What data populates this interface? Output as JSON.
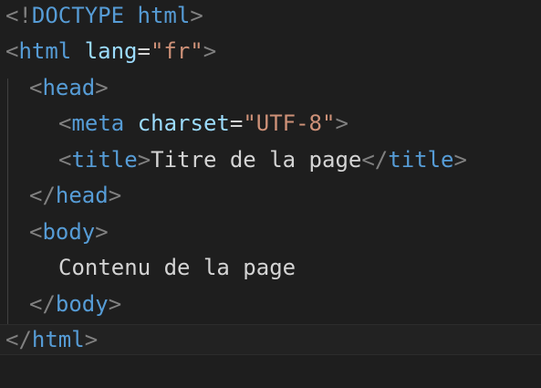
{
  "editor": {
    "language": "html",
    "highlighted_line": 9,
    "colors": {
      "background": "#1e1e1e",
      "tag": "#569cd6",
      "bracket": "#808080",
      "attribute": "#9cdcfe",
      "string": "#ce9178",
      "text": "#d4d4d4"
    },
    "lines": {
      "l1": {
        "open": "<!",
        "name": "DOCTYPE",
        "attr": "html",
        "close": ">"
      },
      "l2": {
        "open": "<",
        "name": "html",
        "attr": "lang",
        "eq": "=",
        "value": "\"fr\"",
        "close": ">"
      },
      "l3": {
        "open": "<",
        "name": "head",
        "close": ">"
      },
      "l4": {
        "open": "<",
        "name": "meta",
        "attr": "charset",
        "eq": "=",
        "value": "\"UTF-8\"",
        "close": ">"
      },
      "l5": {
        "open": "<",
        "name": "title",
        "close": ">",
        "text": "Titre de la page",
        "end_open": "</",
        "end_name": "title",
        "end_close": ">"
      },
      "l6": {
        "open": "</",
        "name": "head",
        "close": ">"
      },
      "l7": {
        "open": "<",
        "name": "body",
        "close": ">"
      },
      "l8": {
        "text": "Contenu de la page"
      },
      "l9": {
        "open": "</",
        "name": "body",
        "close": ">"
      },
      "l10": {
        "open": "</",
        "name": "html",
        "close": ">"
      }
    }
  }
}
